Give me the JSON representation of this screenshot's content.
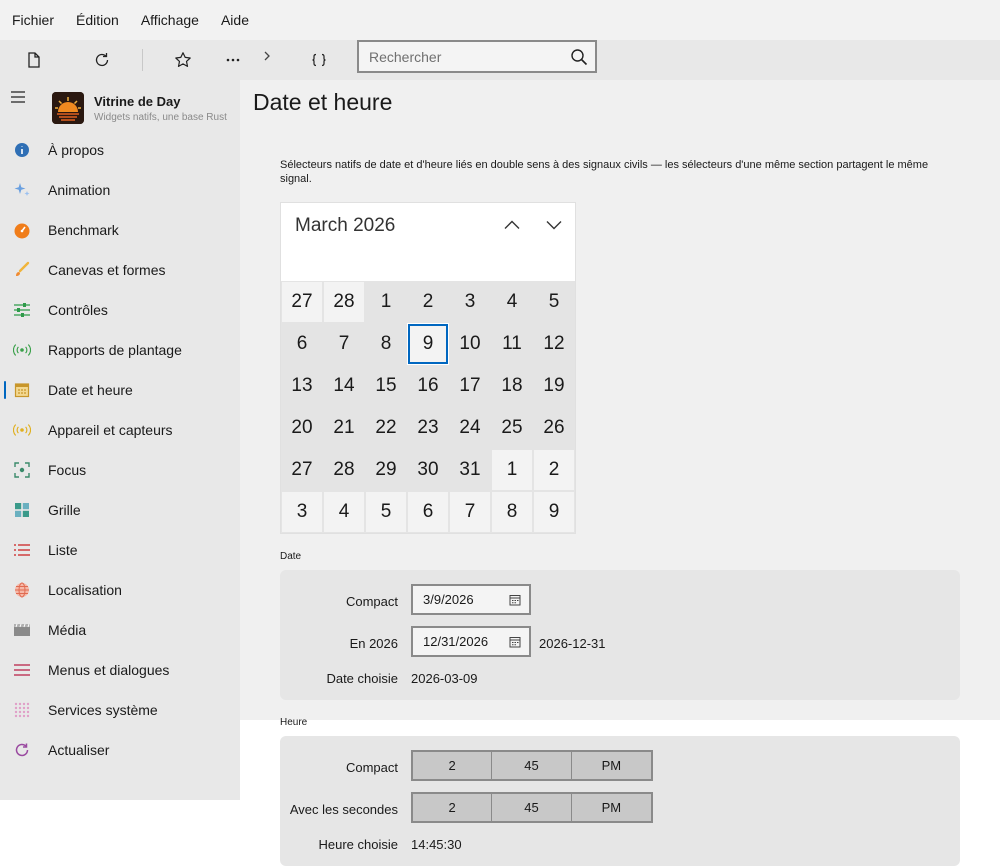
{
  "menubar": {
    "items": [
      "Fichier",
      "Édition",
      "Affichage",
      "Aide"
    ]
  },
  "toolbar": {
    "search_placeholder": "Rechercher"
  },
  "sidebar": {
    "app_title": "Vitrine de Day",
    "app_subtitle": "Widgets natifs, une base Rust",
    "items": [
      {
        "label": "À propos",
        "icon": "info-icon",
        "color": "#2f6fb5"
      },
      {
        "label": "Animation",
        "icon": "sparkle-icon",
        "color": "#6aa0e0"
      },
      {
        "label": "Benchmark",
        "icon": "gauge-icon",
        "color": "#f07d1a"
      },
      {
        "label": "Canevas et formes",
        "icon": "brush-icon",
        "color": "#f0b43a"
      },
      {
        "label": "Contrôles",
        "icon": "sliders-icon",
        "color": "#2e9a4a"
      },
      {
        "label": "Rapports de plantage",
        "icon": "broadcast-icon",
        "color": "#3aa04a"
      },
      {
        "label": "Date et heure",
        "icon": "calendar-icon",
        "color": "#c8962a"
      },
      {
        "label": "Appareil et capteurs",
        "icon": "sensor-icon",
        "color": "#e0b020"
      },
      {
        "label": "Focus",
        "icon": "focus-icon",
        "color": "#3a8a6a"
      },
      {
        "label": "Grille",
        "icon": "grid-icon",
        "color": "#3a9a8a"
      },
      {
        "label": "Liste",
        "icon": "list-icon",
        "color": "#d04040"
      },
      {
        "label": "Localisation",
        "icon": "globe-icon",
        "color": "#e06a50"
      },
      {
        "label": "Média",
        "icon": "film-icon",
        "color": "#8a8a8a"
      },
      {
        "label": "Menus et dialogues",
        "icon": "menu-icon",
        "color": "#c04060"
      },
      {
        "label": "Services système",
        "icon": "dots-grid-icon",
        "color": "#c05a9a"
      },
      {
        "label": "Actualiser",
        "icon": "refresh-icon",
        "color": "#9a4aa0"
      }
    ],
    "active_index": 6
  },
  "main": {
    "title": "Date et heure",
    "description": "Sélecteurs natifs de date et d'heure liés en double sens à des signaux civils — les sélecteurs d'une même section partagent le même signal.",
    "calendar": {
      "month_label": "March 2026",
      "days": [
        [
          "27",
          "28",
          "1",
          "2",
          "3",
          "4",
          "5"
        ],
        [
          "6",
          "7",
          "8",
          "9",
          "10",
          "11",
          "12"
        ],
        [
          "13",
          "14",
          "15",
          "16",
          "17",
          "18",
          "19"
        ],
        [
          "20",
          "21",
          "22",
          "23",
          "24",
          "25",
          "26"
        ],
        [
          "27",
          "28",
          "29",
          "30",
          "31",
          "1",
          "2"
        ],
        [
          "3",
          "4",
          "5",
          "6",
          "7",
          "8",
          "9"
        ]
      ],
      "today": "9"
    },
    "date_section": {
      "label": "Date",
      "compact_label": "Compact",
      "compact_value": "3/9/2026",
      "year_label": "En 2026",
      "year_value": "12/31/2026",
      "year_iso": "2026-12-31",
      "chosen_label": "Date choisie",
      "chosen_value": "2026-03-09"
    },
    "time_section": {
      "label": "Heure",
      "compact_label": "Compact",
      "compact": {
        "hour": "2",
        "minute": "45",
        "period": "PM"
      },
      "seconds_label": "Avec les secondes",
      "seconds": {
        "hour": "2",
        "minute": "45",
        "period": "PM"
      },
      "chosen_label": "Heure choisie",
      "chosen_value": "14:45:30"
    }
  }
}
